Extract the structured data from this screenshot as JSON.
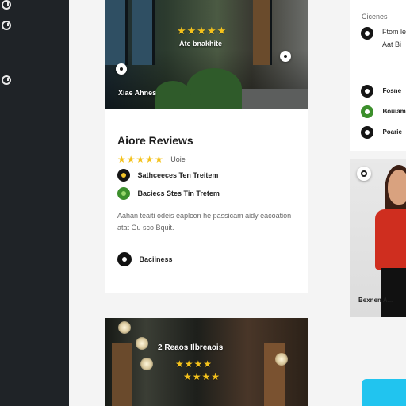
{
  "rail": {
    "icons": [
      "info-icon",
      "info-icon",
      "info-icon"
    ]
  },
  "hero": {
    "stars": "★★★★★",
    "title": "Ate bnakhite",
    "caption": "Xiae Ahnes"
  },
  "card": {
    "title": "Aiore Reviews",
    "rating_stars": "★★★★★",
    "rating_label": "Uoie",
    "amenities": [
      {
        "icon": "pin-icon",
        "label": "Sathceeces Ten Treitem"
      },
      {
        "icon": "leaf-icon",
        "label": "Baciecs Stes Tin Tretem"
      }
    ],
    "description": "Aahan teaiti odeis eaplcon he passicam aidy eacoation atat Gu sco Bquit.",
    "footer_label": "Baciiness"
  },
  "hero2": {
    "title": "2 Reaos Ilbreaois",
    "stars_row1": "★★★★",
    "stars_row2": "★★★★"
  },
  "side": {
    "heading": "Cicenes",
    "top_line1": "Ftom le",
    "top_line2": "Aat Bi",
    "items": [
      {
        "icon": "circle-icon",
        "label": "Fosne"
      },
      {
        "icon": "leaf-icon",
        "label": "Bouiam"
      },
      {
        "icon": "circle-icon",
        "label": "Poarie"
      }
    ],
    "person_caption": "Bexnen A..."
  },
  "colors": {
    "accent": "#21c4ef",
    "star": "#f4c21c",
    "rail": "#1f2327"
  }
}
